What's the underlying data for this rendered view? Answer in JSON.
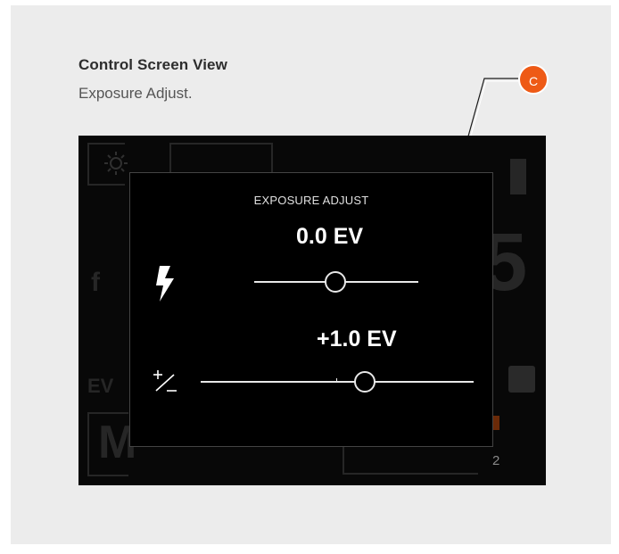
{
  "header": {
    "title": "Control Screen View",
    "subtitle": "Exposure Adjust."
  },
  "callout": {
    "label": "C",
    "color": "#ee5a16"
  },
  "camera_screen": {
    "background_indicators": {
      "f_label": "f",
      "ev_label": "EV",
      "mode_label": "M",
      "page_index": "2"
    },
    "exposure_adjust": {
      "title": "EXPOSURE ADJUST",
      "flash": {
        "icon": "flash-icon",
        "value_label": "0.0 EV"
      },
      "exposure": {
        "icon": "exposure-compensation-icon",
        "value_label": "+1.0 EV"
      }
    }
  }
}
